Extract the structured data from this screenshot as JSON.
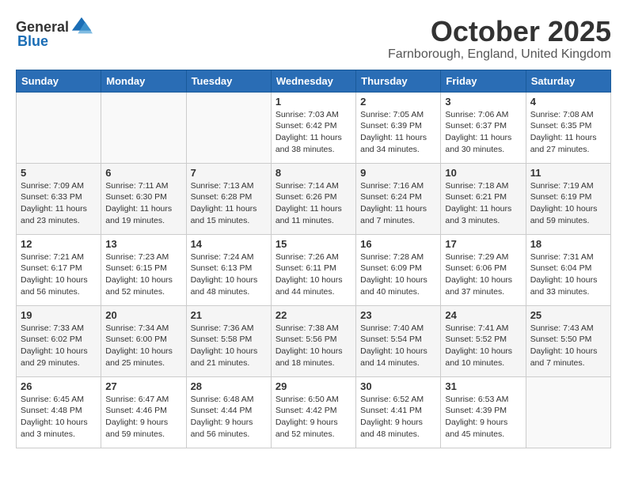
{
  "header": {
    "logo_general": "General",
    "logo_blue": "Blue",
    "month": "October 2025",
    "location": "Farnborough, England, United Kingdom"
  },
  "days_of_week": [
    "Sunday",
    "Monday",
    "Tuesday",
    "Wednesday",
    "Thursday",
    "Friday",
    "Saturday"
  ],
  "weeks": [
    [
      {
        "day": "",
        "info": ""
      },
      {
        "day": "",
        "info": ""
      },
      {
        "day": "",
        "info": ""
      },
      {
        "day": "1",
        "info": "Sunrise: 7:03 AM\nSunset: 6:42 PM\nDaylight: 11 hours\nand 38 minutes."
      },
      {
        "day": "2",
        "info": "Sunrise: 7:05 AM\nSunset: 6:39 PM\nDaylight: 11 hours\nand 34 minutes."
      },
      {
        "day": "3",
        "info": "Sunrise: 7:06 AM\nSunset: 6:37 PM\nDaylight: 11 hours\nand 30 minutes."
      },
      {
        "day": "4",
        "info": "Sunrise: 7:08 AM\nSunset: 6:35 PM\nDaylight: 11 hours\nand 27 minutes."
      }
    ],
    [
      {
        "day": "5",
        "info": "Sunrise: 7:09 AM\nSunset: 6:33 PM\nDaylight: 11 hours\nand 23 minutes."
      },
      {
        "day": "6",
        "info": "Sunrise: 7:11 AM\nSunset: 6:30 PM\nDaylight: 11 hours\nand 19 minutes."
      },
      {
        "day": "7",
        "info": "Sunrise: 7:13 AM\nSunset: 6:28 PM\nDaylight: 11 hours\nand 15 minutes."
      },
      {
        "day": "8",
        "info": "Sunrise: 7:14 AM\nSunset: 6:26 PM\nDaylight: 11 hours\nand 11 minutes."
      },
      {
        "day": "9",
        "info": "Sunrise: 7:16 AM\nSunset: 6:24 PM\nDaylight: 11 hours\nand 7 minutes."
      },
      {
        "day": "10",
        "info": "Sunrise: 7:18 AM\nSunset: 6:21 PM\nDaylight: 11 hours\nand 3 minutes."
      },
      {
        "day": "11",
        "info": "Sunrise: 7:19 AM\nSunset: 6:19 PM\nDaylight: 10 hours\nand 59 minutes."
      }
    ],
    [
      {
        "day": "12",
        "info": "Sunrise: 7:21 AM\nSunset: 6:17 PM\nDaylight: 10 hours\nand 56 minutes."
      },
      {
        "day": "13",
        "info": "Sunrise: 7:23 AM\nSunset: 6:15 PM\nDaylight: 10 hours\nand 52 minutes."
      },
      {
        "day": "14",
        "info": "Sunrise: 7:24 AM\nSunset: 6:13 PM\nDaylight: 10 hours\nand 48 minutes."
      },
      {
        "day": "15",
        "info": "Sunrise: 7:26 AM\nSunset: 6:11 PM\nDaylight: 10 hours\nand 44 minutes."
      },
      {
        "day": "16",
        "info": "Sunrise: 7:28 AM\nSunset: 6:09 PM\nDaylight: 10 hours\nand 40 minutes."
      },
      {
        "day": "17",
        "info": "Sunrise: 7:29 AM\nSunset: 6:06 PM\nDaylight: 10 hours\nand 37 minutes."
      },
      {
        "day": "18",
        "info": "Sunrise: 7:31 AM\nSunset: 6:04 PM\nDaylight: 10 hours\nand 33 minutes."
      }
    ],
    [
      {
        "day": "19",
        "info": "Sunrise: 7:33 AM\nSunset: 6:02 PM\nDaylight: 10 hours\nand 29 minutes."
      },
      {
        "day": "20",
        "info": "Sunrise: 7:34 AM\nSunset: 6:00 PM\nDaylight: 10 hours\nand 25 minutes."
      },
      {
        "day": "21",
        "info": "Sunrise: 7:36 AM\nSunset: 5:58 PM\nDaylight: 10 hours\nand 21 minutes."
      },
      {
        "day": "22",
        "info": "Sunrise: 7:38 AM\nSunset: 5:56 PM\nDaylight: 10 hours\nand 18 minutes."
      },
      {
        "day": "23",
        "info": "Sunrise: 7:40 AM\nSunset: 5:54 PM\nDaylight: 10 hours\nand 14 minutes."
      },
      {
        "day": "24",
        "info": "Sunrise: 7:41 AM\nSunset: 5:52 PM\nDaylight: 10 hours\nand 10 minutes."
      },
      {
        "day": "25",
        "info": "Sunrise: 7:43 AM\nSunset: 5:50 PM\nDaylight: 10 hours\nand 7 minutes."
      }
    ],
    [
      {
        "day": "26",
        "info": "Sunrise: 6:45 AM\nSunset: 4:48 PM\nDaylight: 10 hours\nand 3 minutes."
      },
      {
        "day": "27",
        "info": "Sunrise: 6:47 AM\nSunset: 4:46 PM\nDaylight: 9 hours\nand 59 minutes."
      },
      {
        "day": "28",
        "info": "Sunrise: 6:48 AM\nSunset: 4:44 PM\nDaylight: 9 hours\nand 56 minutes."
      },
      {
        "day": "29",
        "info": "Sunrise: 6:50 AM\nSunset: 4:42 PM\nDaylight: 9 hours\nand 52 minutes."
      },
      {
        "day": "30",
        "info": "Sunrise: 6:52 AM\nSunset: 4:41 PM\nDaylight: 9 hours\nand 48 minutes."
      },
      {
        "day": "31",
        "info": "Sunrise: 6:53 AM\nSunset: 4:39 PM\nDaylight: 9 hours\nand 45 minutes."
      },
      {
        "day": "",
        "info": ""
      }
    ]
  ]
}
